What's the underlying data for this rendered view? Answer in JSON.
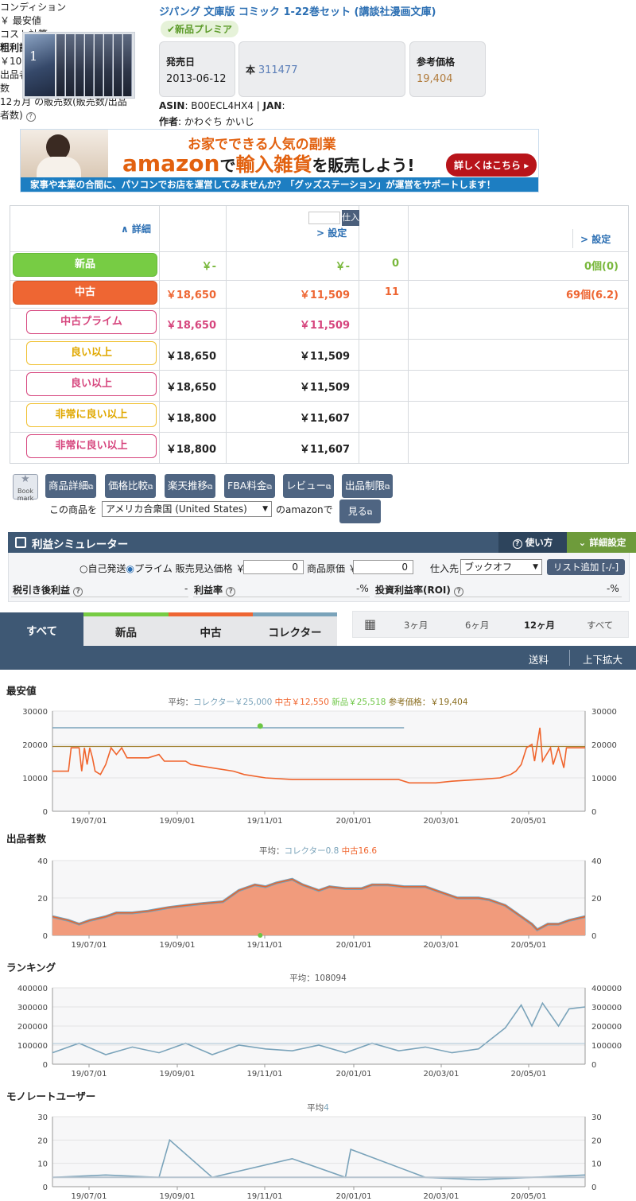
{
  "product": {
    "title": "ジパング 文庫版 コミック 1-22巻セット (講談社漫画文庫)",
    "badge": "✔新品プレミア",
    "release_label": "発売日",
    "release_date": "2013-06-12",
    "category_label": "本",
    "rank": "311477",
    "ref_price_label": "参考価格",
    "ref_price": "19,404",
    "asin_label": "ASIN",
    "asin": "B00ECL4HX4",
    "jan_label": "JAN",
    "author_label": "作者",
    "author": "かわぐち かいじ",
    "cover_glyph": "1"
  },
  "banner": {
    "line1": "お家でできる人気の副業",
    "brand": "amazon",
    "line2_a": "で",
    "line2_b": "輸入雑貨",
    "line2_c": "を販売しよう!",
    "button": "詳しくはこちら",
    "footer": "家事や本業の合間に、パソコンでお店を運営してみませんか？「グッズステーション」が運営をサポートします！"
  },
  "table": {
    "h_condition": "コンディション",
    "h_detail": "∧ 詳細",
    "h_lowest": "￥ 最安値",
    "h_cost": "コスト計算",
    "h_cost_btn": "仕入",
    "h_margin": "粗利設定:",
    "h_margin_val": "￥100/20%",
    "h_setting": "> 設定",
    "h_sellers": "出品者",
    "h_sellers2": "数",
    "h_sales": "12ヵ月 の販売数(販売数/出品",
    "h_sales2": "者数)",
    "rows": [
      {
        "label": "新品",
        "price": "￥-",
        "cost": "￥-",
        "sellers": "0",
        "sales": "0個(0)"
      },
      {
        "label": "中古",
        "price": "￥18,650",
        "cost": "￥11,509",
        "sellers": "11",
        "sales": "69個(6.2)"
      },
      {
        "label": "中古プライム",
        "price": "￥18,650",
        "cost": "￥11,509"
      },
      {
        "label": "良い以上",
        "price": "￥18,650",
        "cost": "￥11,509"
      },
      {
        "label": "良い以上",
        "price": "￥18,650",
        "cost": "￥11,509"
      },
      {
        "label": "非常に良い以上",
        "price": "￥18,800",
        "cost": "￥11,607"
      },
      {
        "label": "非常に良い以上",
        "price": "￥18,800",
        "cost": "￥11,607"
      }
    ]
  },
  "actions": {
    "bookmark": "Book mark",
    "buttons": [
      "商品詳細",
      "価格比較",
      "楽天推移",
      "FBA料金",
      "レビュー",
      "出品制限"
    ],
    "compare_prefix": "この商品を",
    "country": "アメリカ合衆国 (United States)",
    "compare_suffix": "のamazonで",
    "see": "見る"
  },
  "simulator": {
    "title": "利益シミュレーター",
    "howto": "使い方",
    "detail": "詳細設定",
    "self_ship": "自己発送",
    "prime": "プライム",
    "sell_label": "販売見込価格 ￥",
    "sell_value": "0",
    "cost_label": "商品原価 ￥",
    "cost_value": "0",
    "supplier_label": "仕入先",
    "supplier": "ブックオフ",
    "list_add": "リスト追加 [-/-]",
    "profit_label": "税引き後利益",
    "profit_value": "-",
    "rate_label": "利益率",
    "rate_value": "-%",
    "roi_label": "投資利益率(ROI)",
    "roi_value": "-%"
  },
  "tabs": {
    "all": "すべて",
    "new": "新品",
    "used": "中古",
    "collector": "コレクター",
    "p3": "3ヶ月",
    "p6": "6ヶ月",
    "p12": "12ヶ月",
    "pall": "すべて",
    "shipping": "送料",
    "zoom": "上下拡大"
  },
  "colors": {
    "new": "#6cc644",
    "used": "#f0642c",
    "collector": "#7aa3ba",
    "ref": "#8a6d1f",
    "nav": "#3e5874",
    "link": "#2c6fb3"
  },
  "chart_data": [
    {
      "type": "line",
      "title": "最安値",
      "subtitle_prefix": "平均：",
      "legend": [
        {
          "name": "コレクター￥25,000",
          "color": "#7aa3ba"
        },
        {
          "name": "中古￥12,550",
          "color": "#f0642c"
        },
        {
          "name": "新品￥25,518",
          "color": "#6cc644"
        },
        {
          "name": "参考価格：￥19,404",
          "color": "#8a6d1f"
        }
      ],
      "x_ticks": [
        "19/07/01",
        "19/09/01",
        "19/11/01",
        "20/01/01",
        "20/03/01",
        "20/05/01"
      ],
      "y_ticks": [
        "0",
        "10000",
        "20000",
        "30000"
      ],
      "ylim": [
        0,
        30000
      ],
      "series": [
        {
          "name": "コレクター",
          "values": [
            [
              0,
              25000
            ],
            [
              0.66,
              25000
            ]
          ]
        },
        {
          "name": "参考価格",
          "values": [
            [
              0,
              19404
            ],
            [
              1,
              19404
            ]
          ]
        },
        {
          "name": "新品",
          "values": [
            [
              0.39,
              25518
            ]
          ]
        },
        {
          "name": "中古",
          "values": [
            [
              0,
              12000
            ],
            [
              0.03,
              12000
            ],
            [
              0.035,
              19000
            ],
            [
              0.05,
              19000
            ],
            [
              0.055,
              12000
            ],
            [
              0.06,
              19000
            ],
            [
              0.065,
              14000
            ],
            [
              0.07,
              19000
            ],
            [
              0.075,
              16000
            ],
            [
              0.08,
              12000
            ],
            [
              0.09,
              11000
            ],
            [
              0.1,
              14000
            ],
            [
              0.11,
              19000
            ],
            [
              0.12,
              17000
            ],
            [
              0.13,
              19000
            ],
            [
              0.14,
              16000
            ],
            [
              0.18,
              16000
            ],
            [
              0.2,
              17000
            ],
            [
              0.21,
              15000
            ],
            [
              0.25,
              15000
            ],
            [
              0.26,
              14000
            ],
            [
              0.3,
              13000
            ],
            [
              0.34,
              12000
            ],
            [
              0.36,
              11000
            ],
            [
              0.4,
              10000
            ],
            [
              0.45,
              9500
            ],
            [
              0.5,
              9500
            ],
            [
              0.55,
              9500
            ],
            [
              0.6,
              9500
            ],
            [
              0.65,
              9500
            ],
            [
              0.67,
              8500
            ],
            [
              0.72,
              8500
            ],
            [
              0.75,
              9000
            ],
            [
              0.8,
              9500
            ],
            [
              0.84,
              10000
            ],
            [
              0.86,
              11000
            ],
            [
              0.87,
              12000
            ],
            [
              0.88,
              14000
            ],
            [
              0.89,
              19000
            ],
            [
              0.9,
              20000
            ],
            [
              0.905,
              15000
            ],
            [
              0.91,
              20000
            ],
            [
              0.915,
              25000
            ],
            [
              0.92,
              15000
            ],
            [
              0.935,
              19000
            ],
            [
              0.94,
              14000
            ],
            [
              0.95,
              19000
            ],
            [
              0.96,
              13000
            ],
            [
              0.965,
              19000
            ],
            [
              1,
              19000
            ]
          ]
        }
      ]
    },
    {
      "type": "area",
      "title": "出品者数",
      "subtitle_prefix": "平均：",
      "legend": [
        {
          "name": "コレクター0.8",
          "color": "#7aa3ba"
        },
        {
          "name": "中古16.6",
          "color": "#f0642c"
        }
      ],
      "x_ticks": [
        "19/07/01",
        "19/09/01",
        "19/11/01",
        "20/01/01",
        "20/03/01",
        "20/05/01"
      ],
      "y_ticks": [
        "0",
        "20",
        "40"
      ],
      "ylim": [
        0,
        40
      ],
      "series": [
        {
          "name": "中古",
          "values": [
            [
              0,
              10
            ],
            [
              0.03,
              8
            ],
            [
              0.05,
              6
            ],
            [
              0.07,
              8
            ],
            [
              0.1,
              10
            ],
            [
              0.12,
              12
            ],
            [
              0.15,
              12
            ],
            [
              0.18,
              13
            ],
            [
              0.2,
              14
            ],
            [
              0.22,
              15
            ],
            [
              0.25,
              16
            ],
            [
              0.28,
              17
            ],
            [
              0.32,
              18
            ],
            [
              0.35,
              24
            ],
            [
              0.38,
              27
            ],
            [
              0.4,
              26
            ],
            [
              0.42,
              28
            ],
            [
              0.45,
              30
            ],
            [
              0.47,
              27
            ],
            [
              0.5,
              24
            ],
            [
              0.52,
              26
            ],
            [
              0.55,
              25
            ],
            [
              0.58,
              25
            ],
            [
              0.6,
              27
            ],
            [
              0.63,
              27
            ],
            [
              0.66,
              26
            ],
            [
              0.7,
              26
            ],
            [
              0.73,
              23
            ],
            [
              0.76,
              20
            ],
            [
              0.8,
              20
            ],
            [
              0.82,
              19
            ],
            [
              0.85,
              16
            ],
            [
              0.88,
              10
            ],
            [
              0.9,
              6
            ],
            [
              0.91,
              3
            ],
            [
              0.93,
              6
            ],
            [
              0.95,
              6
            ],
            [
              0.97,
              8
            ],
            [
              1,
              10
            ]
          ]
        }
      ]
    },
    {
      "type": "line",
      "title": "ランキング",
      "subtitle_prefix": "平均：",
      "legend": [
        {
          "name": "108094",
          "color": "#555555"
        }
      ],
      "x_ticks": [
        "19/07/01",
        "19/09/01",
        "19/11/01",
        "20/01/01",
        "20/03/01",
        "20/05/01"
      ],
      "y_ticks": [
        "0",
        "100000",
        "200000",
        "300000",
        "400000"
      ],
      "ylim": [
        0,
        400000
      ],
      "series": [
        {
          "name": "ランキング",
          "values": [
            [
              0,
              60000
            ],
            [
              0.05,
              110000
            ],
            [
              0.1,
              50000
            ],
            [
              0.15,
              90000
            ],
            [
              0.2,
              60000
            ],
            [
              0.25,
              110000
            ],
            [
              0.3,
              50000
            ],
            [
              0.35,
              100000
            ],
            [
              0.4,
              80000
            ],
            [
              0.45,
              70000
            ],
            [
              0.5,
              100000
            ],
            [
              0.55,
              60000
            ],
            [
              0.6,
              110000
            ],
            [
              0.65,
              70000
            ],
            [
              0.7,
              90000
            ],
            [
              0.75,
              60000
            ],
            [
              0.8,
              80000
            ],
            [
              0.85,
              190000
            ],
            [
              0.88,
              310000
            ],
            [
              0.9,
              200000
            ],
            [
              0.92,
              320000
            ],
            [
              0.95,
              200000
            ],
            [
              0.97,
              290000
            ],
            [
              1,
              300000
            ]
          ]
        }
      ]
    },
    {
      "type": "line",
      "title": "モノレートユーザー",
      "subtitle_prefix": "平均",
      "legend": [
        {
          "name": "4",
          "color": "#7aa3ba"
        }
      ],
      "x_ticks": [
        "19/07/01",
        "19/09/01",
        "19/11/01",
        "20/01/01",
        "20/03/01",
        "20/05/01"
      ],
      "y_ticks": [
        "0",
        "10",
        "20",
        "30"
      ],
      "ylim": [
        0,
        30
      ],
      "series": [
        {
          "name": "モノレートユーザー",
          "values": [
            [
              0,
              4
            ],
            [
              0.1,
              5
            ],
            [
              0.2,
              4
            ],
            [
              0.22,
              20
            ],
            [
              0.3,
              4
            ],
            [
              0.45,
              12
            ],
            [
              0.55,
              4
            ],
            [
              0.56,
              16
            ],
            [
              0.7,
              4
            ],
            [
              0.8,
              3
            ],
            [
              0.9,
              4
            ],
            [
              1,
              5
            ]
          ]
        }
      ]
    }
  ]
}
